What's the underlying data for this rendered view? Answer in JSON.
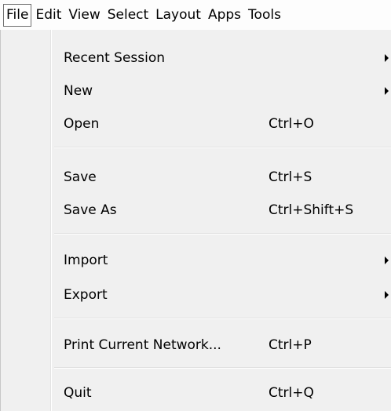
{
  "menubar": {
    "items": [
      "File",
      "Edit",
      "View",
      "Select",
      "Layout",
      "Apps",
      "Tools"
    ]
  },
  "file_menu": {
    "items": [
      {
        "label": "Recent Session",
        "shortcut": "",
        "submenu": true
      },
      {
        "label": "New",
        "shortcut": "",
        "submenu": true
      },
      {
        "label": "Open",
        "shortcut": "Ctrl+O",
        "submenu": false
      },
      {
        "label": "Save",
        "shortcut": "Ctrl+S",
        "submenu": false
      },
      {
        "label": "Save As",
        "shortcut": "Ctrl+Shift+S",
        "submenu": false
      },
      {
        "label": "Import",
        "shortcut": "",
        "submenu": true
      },
      {
        "label": "Export",
        "shortcut": "",
        "submenu": true
      },
      {
        "label": "Print Current Network...",
        "shortcut": "Ctrl+P",
        "submenu": false
      },
      {
        "label": "Quit",
        "shortcut": "Ctrl+Q",
        "submenu": false
      }
    ]
  },
  "colors": {
    "menu_background": "#f0f0f0",
    "menubar_background": "#fdfdfd",
    "separator": "#e0e0e0"
  }
}
